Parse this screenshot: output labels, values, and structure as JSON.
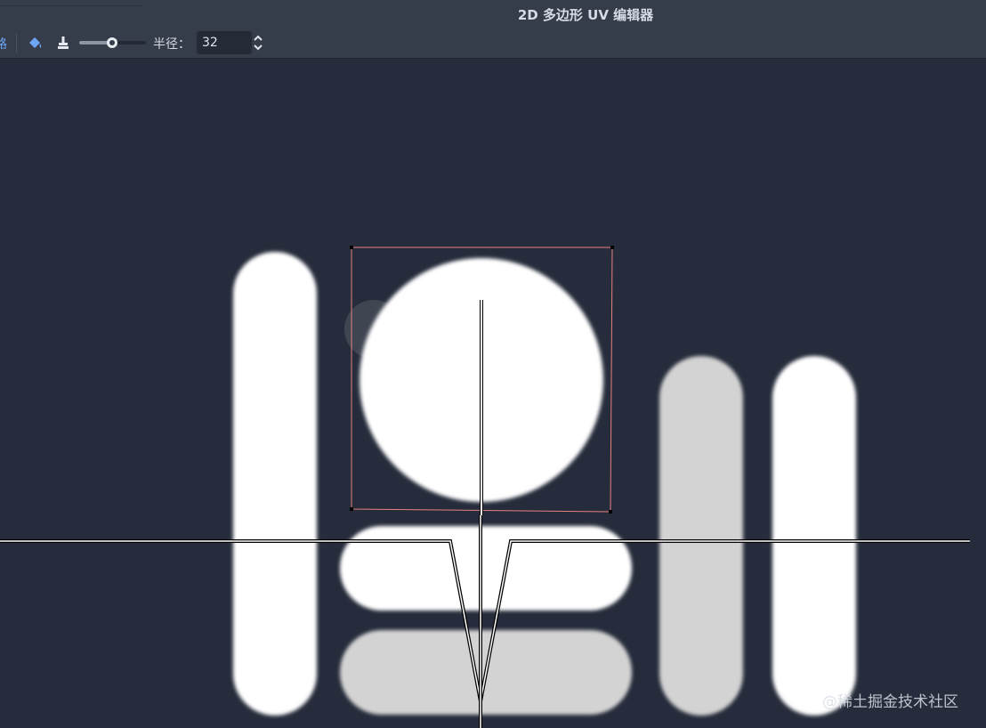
{
  "window": {
    "title": "2D 多边形 UV 编辑器"
  },
  "toolbar": {
    "radius_label": "半径：",
    "radius_value": "32",
    "slider_value_fraction": 0.49,
    "left_cut_glyph": "路",
    "icons": {
      "bucket": "paint-bucket-icon",
      "brush": "brush-clear-icon",
      "spin": "spin-arrows-icon"
    }
  },
  "watermark": "@稀土掘金技术社区",
  "colors": {
    "background": "#262c3b",
    "panel": "#363d4a",
    "accent": "#6ea5f5",
    "polygon_outline": "#e88080",
    "shape_white": "#ffffff",
    "shape_gray": "#d3d3d3"
  }
}
